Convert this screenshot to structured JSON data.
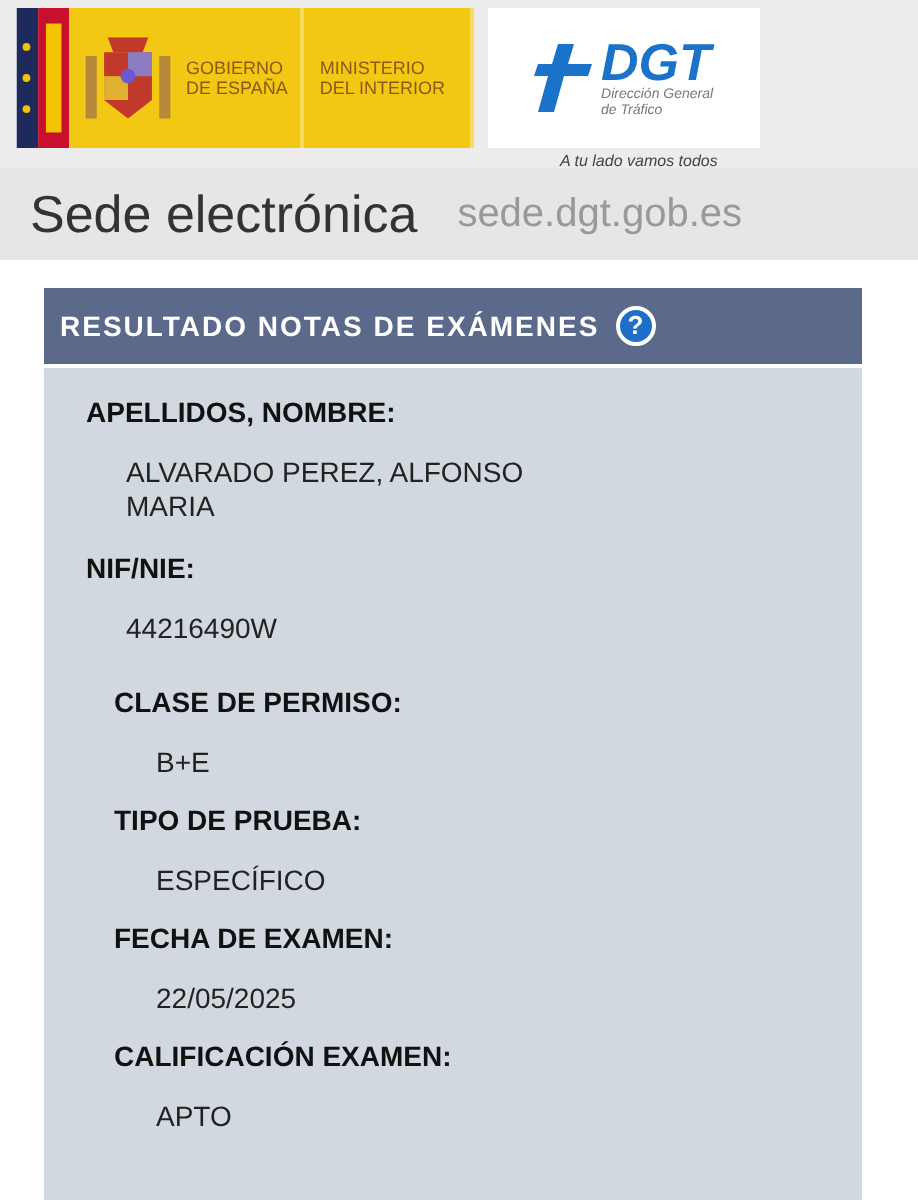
{
  "header": {
    "government": [
      "GOBIERNO",
      "DE ESPAÑA"
    ],
    "ministry": [
      "MINISTERIO",
      "DEL INTERIOR"
    ],
    "agency": {
      "acronym": "DGT",
      "name": [
        "Dirección General",
        "de Tráfico"
      ]
    },
    "slogan": "A tu lado vamos todos"
  },
  "site": {
    "title": "Sede electrónica",
    "url": "sede.dgt.gob.es"
  },
  "panel": {
    "title": "RESULTADO NOTAS DE EXÁMENES",
    "help": "?",
    "groups": [
      {
        "kind": "outer",
        "fields": [
          {
            "label": "APELLIDOS, NOMBRE:",
            "value": "ALVARADO PEREZ, ALFONSO MARIA"
          },
          {
            "label": "NIF/NIE:",
            "value": "44216490W"
          }
        ]
      },
      {
        "kind": "inner",
        "fields": [
          {
            "label": "CLASE DE PERMISO:",
            "value": "B+E"
          },
          {
            "label": "TIPO DE PRUEBA:",
            "value": "ESPECÍFICO"
          },
          {
            "label": "FECHA DE EXAMEN:",
            "value": "22/05/2025"
          },
          {
            "label": "CALIFICACIÓN EXAMEN:",
            "value": "APTO"
          }
        ]
      }
    ]
  }
}
